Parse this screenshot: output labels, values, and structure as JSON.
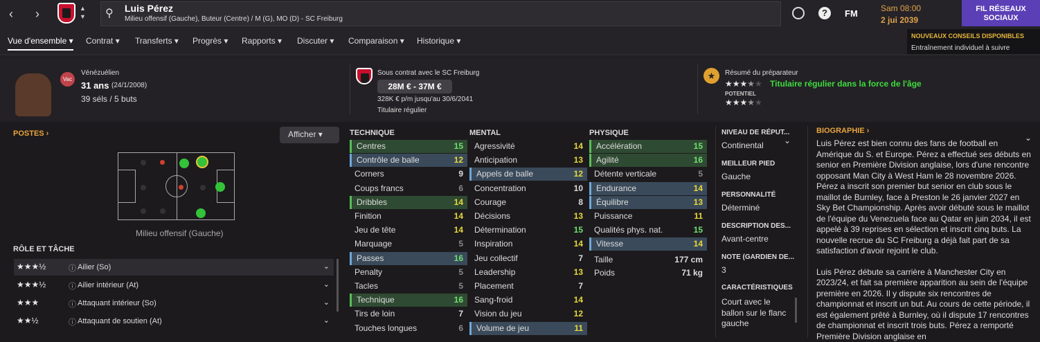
{
  "header": {
    "name": "Luis Pérez",
    "subtitle": "Milieu offensif (Gauche), Buteur (Centre) / M (G), MO (D) - SC Freiburg",
    "time": "Sam 08:00",
    "date": "2 jui 2039",
    "social": "FIL RÉSEAUX SOCIAUX",
    "fm": "FM"
  },
  "notif": {
    "title": "NOUVEAUX CONSEILS DISPONIBLES",
    "text": "Entraînement individuel à suivre"
  },
  "menu": [
    "Vue d'ensemble",
    "Contrat",
    "Transferts",
    "Progrès",
    "Rapports",
    "Discuter",
    "Comparaison",
    "Historique"
  ],
  "info": {
    "nationality": "Vénézuélien",
    "nat_badge": "Vac",
    "age": "31 ans",
    "dob": "(24/1/2008)",
    "caps": "39 séls / 5 buts",
    "contract": "Sous contrat avec le SC Freiburg",
    "value": "28M € - 37M €",
    "wage": "328K € p/m jusqu'au 30/6/2041",
    "status": "Titulaire régulier",
    "coach_title": "Résumé du préparateur",
    "coach_text": "Titulaire régulier dans la force de l'âge",
    "potential": "POTENTIEL"
  },
  "positions": {
    "title": "POSTES",
    "show": "Afficher",
    "label": "Milieu offensif (Gauche)",
    "role_title": "RÔLE ET TÂCHE"
  },
  "roles": [
    {
      "name": "Ailier (So)",
      "stars": "★★★½"
    },
    {
      "name": "Ailier intérieur (At)",
      "stars": "★★★½"
    },
    {
      "name": "Attaquant intérieur (So)",
      "stars": "★★★"
    },
    {
      "name": "Attaquant de soutien (At)",
      "stars": "★★½"
    }
  ],
  "tech_title": "TECHNIQUE",
  "mental_title": "MENTAL",
  "phys_title": "PHYSIQUE",
  "technique": [
    [
      "Centres",
      "15"
    ],
    [
      "Contrôle de balle",
      "12"
    ],
    [
      "Corners",
      "9"
    ],
    [
      "Coups francs",
      "6"
    ],
    [
      "Dribbles",
      "14"
    ],
    [
      "Finition",
      "14"
    ],
    [
      "Jeu de tête",
      "14"
    ],
    [
      "Marquage",
      "5"
    ],
    [
      "Passes",
      "16"
    ],
    [
      "Penalty",
      "5"
    ],
    [
      "Tacles",
      "5"
    ],
    [
      "Technique",
      "16"
    ],
    [
      "Tirs de loin",
      "7"
    ],
    [
      "Touches longues",
      "6"
    ]
  ],
  "mental": [
    [
      "Agressivité",
      "14"
    ],
    [
      "Anticipation",
      "13"
    ],
    [
      "Appels de balle",
      "12"
    ],
    [
      "Concentration",
      "10"
    ],
    [
      "Courage",
      "8"
    ],
    [
      "Décisions",
      "13"
    ],
    [
      "Détermination",
      "15"
    ],
    [
      "Inspiration",
      "14"
    ],
    [
      "Jeu collectif",
      "7"
    ],
    [
      "Leadership",
      "13"
    ],
    [
      "Placement",
      "7"
    ],
    [
      "Sang-froid",
      "14"
    ],
    [
      "Vision du jeu",
      "12"
    ],
    [
      "Volume de jeu",
      "11"
    ]
  ],
  "physique": [
    [
      "Accélération",
      "15"
    ],
    [
      "Agilité",
      "16"
    ],
    [
      "Détente verticale",
      "5"
    ],
    [
      "Endurance",
      "14"
    ],
    [
      "Équilibre",
      "13"
    ],
    [
      "Puissance",
      "11"
    ],
    [
      "Qualités phys. nat.",
      "15"
    ],
    [
      "Vitesse",
      "14"
    ]
  ],
  "height": [
    "Taille",
    "177 cm"
  ],
  "weight": [
    "Poids",
    "71 kg"
  ],
  "side": [
    [
      "NIVEAU DE RÉPUT...",
      "Continental"
    ],
    [
      "MEILLEUR PIED",
      "Gauche"
    ],
    [
      "PERSONNALITÉ",
      "Déterminé"
    ],
    [
      "DESCRIPTION DES...",
      "Avant-centre"
    ],
    [
      "NOTE (GARDIEN DE...",
      "3"
    ],
    [
      "CARACTÉRISTIQUES",
      "Court avec le ballon sur le flanc gauche"
    ]
  ],
  "bio_title": "BIOGRAPHIE",
  "bio": [
    "Luis Pérez est bien connu des fans de football en Amérique du S. et Europe. Pérez a effectué ses débuts en senior en Première Division anglaise, lors d'une rencontre opposant Man City à West Ham le 28 novembre 2026. Pérez a inscrit son premier but senior en club sous le maillot de Burnley, face à Preston le 26 janvier 2027 en Sky Bet Championship. Après avoir débuté sous le maillot de l'équipe du Venezuela face au Qatar en juin 2034, il est appelé à 39 reprises en sélection et inscrit cinq buts. La nouvelle recrue du SC Freiburg a déjà fait part de sa satisfaction d'avoir rejoint le club.",
    "Luis Pérez débute sa carrière à Manchester City en 2023/24, et fait sa première apparition au sein de l'équipe première en 2026. Il y dispute six rencontres de championnat et inscrit un but. Au cours de cette période, il est également prêté à Burnley, où il dispute 17 rencontres de championnat et inscrit trois buts. Pérez a remporté Première Division anglaise en"
  ]
}
